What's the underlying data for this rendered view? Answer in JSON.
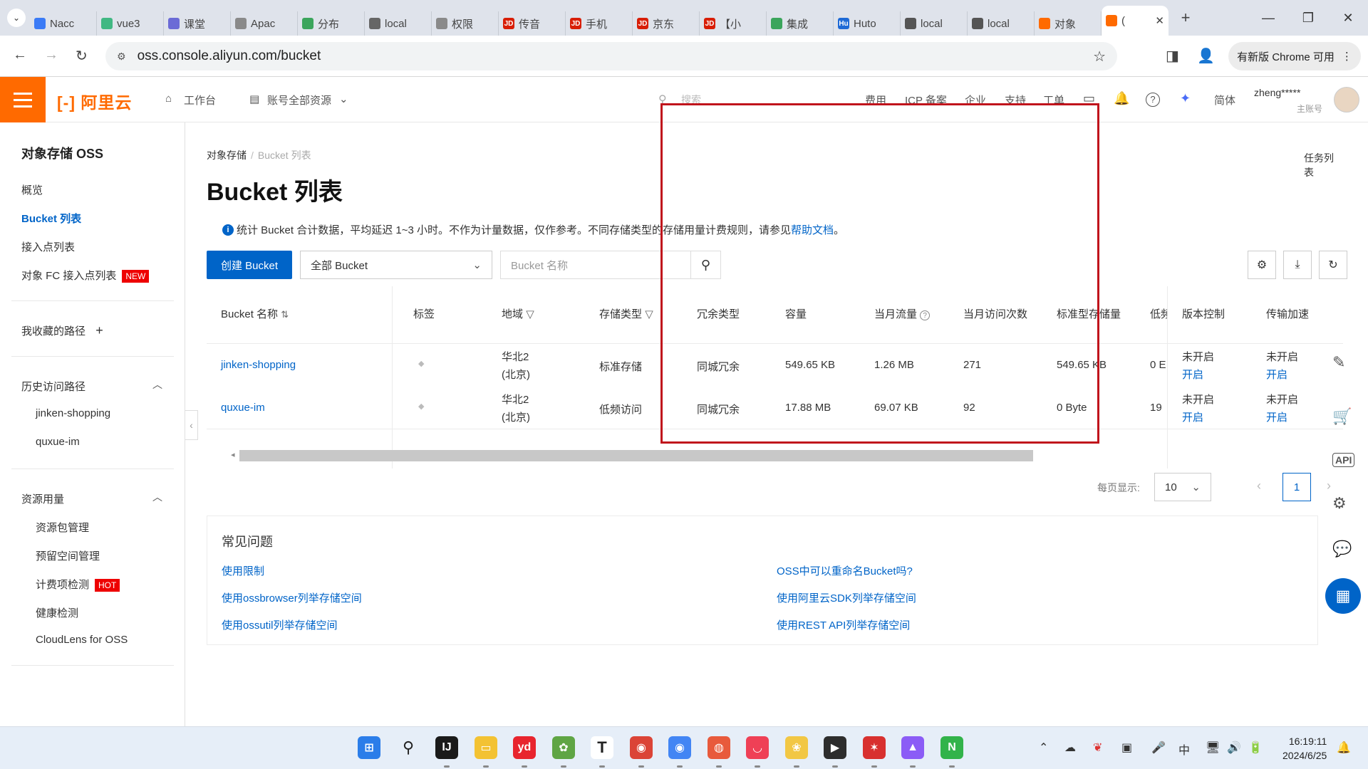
{
  "browser": {
    "tabs": [
      {
        "label": "Nacc",
        "icon": "nacos-icon",
        "color": "#3b7bf6"
      },
      {
        "label": "vue3",
        "icon": "vue-icon",
        "color": "#41b883"
      },
      {
        "label": "课堂",
        "icon": "chrome-site-icon",
        "color": "#6b6bd6"
      },
      {
        "label": "Apac",
        "icon": "chrome-site-icon",
        "color": "#8a8a8a"
      },
      {
        "label": "分布",
        "icon": "shield-icon",
        "color": "#3ba55c"
      },
      {
        "label": "local",
        "icon": "globe-icon",
        "color": "#666666"
      },
      {
        "label": "权限",
        "icon": "globe-icon",
        "color": "#8a8a8a"
      },
      {
        "label": "传音",
        "icon": "jd-icon",
        "color": "#d81e06"
      },
      {
        "label": "手机",
        "icon": "jd-icon",
        "color": "#d81e06"
      },
      {
        "label": "京东",
        "icon": "jd-icon",
        "color": "#d81e06"
      },
      {
        "label": "【小",
        "icon": "jd-icon",
        "color": "#d81e06"
      },
      {
        "label": "集成",
        "icon": "shield-icon",
        "color": "#3ba55c"
      },
      {
        "label": "Huto",
        "icon": "hutool-icon",
        "color": "#1e6ad6"
      },
      {
        "label": "local",
        "icon": "globe-icon",
        "color": "#555555"
      },
      {
        "label": "local",
        "icon": "globe-icon",
        "color": "#555555"
      },
      {
        "label": "对象",
        "icon": "aliyun-icon",
        "color": "#ff6a00"
      },
      {
        "label": "(",
        "icon": "aliyun-icon",
        "color": "#ff6a00",
        "active": true
      }
    ],
    "menu_glyph": "⌄",
    "jd_text": "JD",
    "hu_text": "Hu",
    "aliyun_glyph": "[-]",
    "close_glyph": "✕",
    "newtab_glyph": "+",
    "minimize_glyph": "—",
    "maximize_glyph": "❐",
    "winclose_glyph": "✕",
    "back_glyph": "←",
    "forward_glyph": "→",
    "reload_glyph": "↻",
    "site_glyph": "⚙",
    "url": "oss.console.aliyun.com/bucket",
    "star_glyph": "☆",
    "update_label": "有新版 Chrome 可用",
    "more_glyph": "⋮",
    "sidepanel_glyph": "◨",
    "profile_glyph": "👤"
  },
  "header": {
    "logo_glyph": "[-]",
    "logo_text": "阿里云",
    "home_glyph": "⌂",
    "workbench": "工作台",
    "resource_glyph": "▤",
    "resources": "账号全部资源",
    "chev": "⌄",
    "search_glyph": "⚲",
    "search_placeholder": "搜索",
    "links": [
      "费用",
      "ICP 备案",
      "企业",
      "支持",
      "工单"
    ],
    "terminal_glyph": "▭",
    "bell_glyph": "🔔",
    "help_glyph": "?",
    "ai_glyph": "✦",
    "lang": "简体",
    "username": "zheng*****",
    "account_type": "主账号"
  },
  "sidebar": {
    "title": "对象存储 OSS",
    "items": [
      "概览",
      "Bucket 列表",
      "接入点列表"
    ],
    "fc_item": "对象 FC 接入点列表",
    "new_badge": "NEW",
    "favorites": "我收藏的路径",
    "plus_glyph": "+",
    "history": "历史访问路径",
    "history_items": [
      "jinken-shopping",
      "quxue-im"
    ],
    "usage": "资源用量",
    "usage_items": [
      "资源包管理",
      "预留空间管理",
      "计费项检测",
      "健康检测",
      "CloudLens for OSS"
    ],
    "hot_badge": "HOT",
    "chev_up": "︿",
    "collapse_glyph": "‹"
  },
  "main": {
    "breadcrumb": [
      "对象存储",
      "Bucket 列表"
    ],
    "crumb_sep": "/",
    "task_list": "任务列表",
    "title": "Bucket 列表",
    "info_glyph": "i",
    "notice": "统计 Bucket 合计数据，平均延迟 1~3 小时。不作为计量数据，仅作参考。不同存储类型的存储用量计费规则，请参见",
    "notice_link": "帮助文档",
    "notice_end": "。",
    "create_button": "创建 Bucket",
    "filter_select": "全部 Bucket",
    "search_placeholder": "Bucket 名称",
    "search_glyph": "⚲",
    "settings_glyph": "⚙",
    "download_glyph": "⤓",
    "refresh_glyph": "↻",
    "columns": [
      "Bucket 名称",
      "标签",
      "地域",
      "存储类型",
      "冗余类型",
      "容量",
      "当月流量",
      "当月访问次数",
      "标准型存储量",
      "低频",
      "版本控制",
      "传输加速"
    ],
    "sort_glyph": "⇅",
    "filter_glyph": "▽",
    "question_glyph": "?",
    "tag_glyph": "◆",
    "rows": [
      {
        "name": "jinken-shopping",
        "region1": "华北2",
        "region2": "(北京)",
        "storage": "标准存储",
        "redundancy": "同城冗余",
        "capacity": "549.65 KB",
        "traffic": "1.26 MB",
        "visits": "271",
        "standard": "549.65 KB",
        "low": "0 E",
        "version_status": "未开启",
        "version_action": "开启",
        "accel_status": "未开启",
        "accel_action": "开启"
      },
      {
        "name": "quxue-im",
        "region1": "华北2",
        "region2": "(北京)",
        "storage": "低频访问",
        "redundancy": "同城冗余",
        "capacity": "17.88 MB",
        "traffic": "69.07 KB",
        "visits": "92",
        "standard": "0 Byte",
        "low": "19",
        "version_status": "未开启",
        "version_action": "开启",
        "accel_status": "未开启",
        "accel_action": "开启"
      }
    ],
    "scroll_left_glyph": "◂",
    "page_size_label": "每页显示:",
    "page_size": "10",
    "prev_glyph": "‹",
    "next_glyph": "›",
    "current_page": "1"
  },
  "faq": {
    "title": "常见问题",
    "left": [
      "使用限制",
      "使用ossbrowser列举存储空间",
      "使用ossutil列举存储空间"
    ],
    "right": [
      "OSS中可以重命名Bucket吗?",
      "使用阿里云SDK列举存储空间",
      "使用REST API列举存储空间"
    ]
  },
  "float_tools": {
    "edit_glyph": "✎",
    "cart_glyph": "🛒",
    "api_glyph": "API",
    "gear_glyph": "⚙",
    "chat_glyph": "💬",
    "apps_glyph": "▦"
  },
  "taskbar": {
    "apps": [
      {
        "name": "start-icon",
        "glyph": "⊞",
        "color": "#2b7de9"
      },
      {
        "name": "search-icon",
        "glyph": "⚲",
        "color": "#e6eef8"
      },
      {
        "name": "intellij-icon",
        "glyph": "IJ",
        "color": "#1a1a1a"
      },
      {
        "name": "file-explorer-icon",
        "glyph": "▭",
        "color": "#f3c233"
      },
      {
        "name": "youdao-icon",
        "glyph": "yd",
        "color": "#e8242e"
      },
      {
        "name": "photo-icon",
        "glyph": "✿",
        "color": "#5fa544"
      },
      {
        "name": "typora-icon",
        "glyph": "T",
        "color": "#ffffff"
      },
      {
        "name": "chrome-icon",
        "glyph": "◉",
        "color": "#db4437"
      },
      {
        "name": "chrome-dev-icon",
        "glyph": "◉",
        "color": "#4285f4"
      },
      {
        "name": "snail-icon",
        "glyph": "◍",
        "color": "#e85a3c"
      },
      {
        "name": "pocket-icon",
        "glyph": "◡",
        "color": "#ef4056"
      },
      {
        "name": "folder-app-icon",
        "glyph": "❀",
        "color": "#f2c744"
      },
      {
        "name": "terminal-icon",
        "glyph": "▶",
        "color": "#2d2d2d"
      },
      {
        "name": "xmind-icon",
        "glyph": "✶",
        "color": "#d8302f"
      },
      {
        "name": "paint-icon",
        "glyph": "▲",
        "color": "#8b5cf6"
      },
      {
        "name": "navicat-icon",
        "glyph": "N",
        "color": "#32b34a"
      }
    ],
    "tray": [
      "⌃",
      "☁",
      "❦",
      "▣",
      "🎤",
      "中",
      "🖥",
      "🔊",
      "🔋"
    ],
    "time": "16:19:11",
    "date": "2024/6/25",
    "notify_glyph": "🔔"
  },
  "colors": {
    "accent": "#0064c8",
    "brand": "#ff6a00",
    "highlight": "#c0141c",
    "badge": "#e00000"
  }
}
